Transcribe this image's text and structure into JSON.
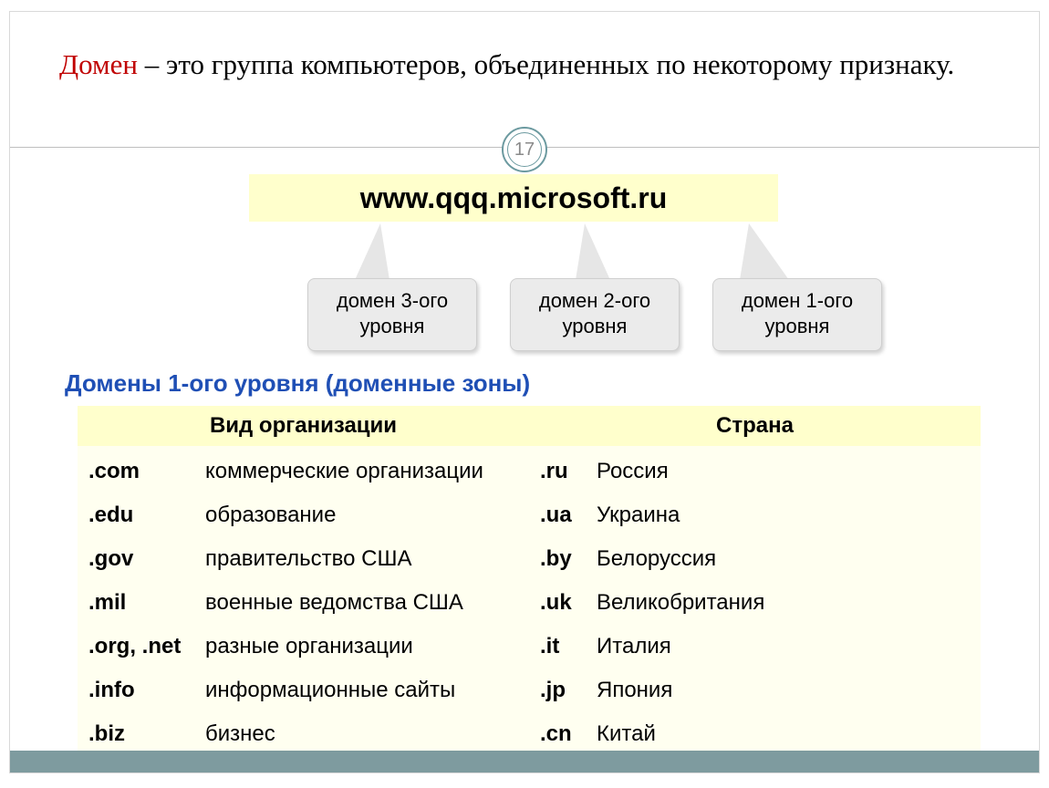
{
  "pageNumber": "17",
  "definition": {
    "keyword": "Домен",
    "rest": " – это группа компьютеров, объединенных по некоторому признаку."
  },
  "exampleUrl": "www.qqq.microsoft.ru",
  "callouts": {
    "level3": "домен 3-ого уровня",
    "level2": "домен 2-ого уровня",
    "level1": "домен 1-ого уровня"
  },
  "subtitle": "Домены 1-ого уровня (доменные зоны)",
  "table": {
    "headers": {
      "org": "Вид организации",
      "country": "Страна"
    },
    "orgRows": [
      {
        "dom": ".com",
        "desc": "коммерческие организации"
      },
      {
        "dom": ".edu",
        "desc": "образование"
      },
      {
        "dom": ".gov",
        "desc": "правительство США"
      },
      {
        "dom": ".mil",
        "desc": "военные ведомства США"
      },
      {
        "dom": ".org, .net",
        "desc": "разные организации"
      },
      {
        "dom": ".info",
        "desc": "информационные сайты"
      },
      {
        "dom": ".biz",
        "desc": "бизнес"
      }
    ],
    "countryRows": [
      {
        "dom": ".ru",
        "desc": "Россия"
      },
      {
        "dom": ".ua",
        "desc": "Украина"
      },
      {
        "dom": ".by",
        "desc": "Белоруссия"
      },
      {
        "dom": ".uk",
        "desc": "Великобритания"
      },
      {
        "dom": ".it",
        "desc": "Италия"
      },
      {
        "dom": ".jp",
        "desc": "Япония"
      },
      {
        "dom": ".cn",
        "desc": "Китай"
      }
    ]
  }
}
